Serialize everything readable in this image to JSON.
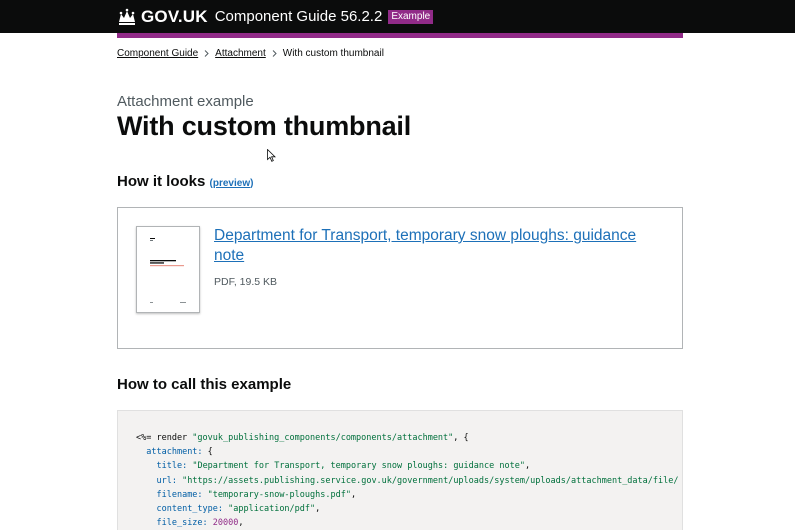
{
  "header": {
    "logo": "GOV.UK",
    "product": "Component Guide 56.2.2",
    "badge": "Example"
  },
  "breadcrumb": {
    "items": [
      "Component Guide",
      "Attachment"
    ],
    "current": "With custom thumbnail"
  },
  "page": {
    "caption": "Attachment example",
    "title": "With custom thumbnail"
  },
  "how_it_looks": {
    "heading": "How it looks",
    "preview_open": "(",
    "preview_label": "preview",
    "preview_close": ")"
  },
  "attachment": {
    "title": "Department for Transport, temporary snow ploughs: guidance note",
    "meta": "PDF, 19.5 KB"
  },
  "how_to_call": {
    "heading": "How to call this example"
  },
  "code": {
    "line1_prefix": "<%= render ",
    "line1_str": "\"govuk_publishing_components/components/attachment\"",
    "line1_suffix": ", {",
    "line2_key": "attachment:",
    "line2_rest": " {",
    "line3_key": "title:",
    "line3_str": "\"Department for Transport, temporary snow ploughs: guidance note\"",
    "line3_rest": ",",
    "line4_key": "url:",
    "line4_str": "\"https://assets.publishing.service.gov.uk/government/uploads/system/uploads/attachment_data/file/",
    "line5_key": "filename:",
    "line5_str": "\"temporary-snow-ploughs.pdf\"",
    "line5_rest": ",",
    "line6_key": "content_type:",
    "line6_str": "\"application/pdf\"",
    "line6_rest": ",",
    "line7_key": "file_size:",
    "line7_num": "20000",
    "line7_rest": ","
  },
  "colors": {
    "header_bg": "#0b0c0c",
    "accent": "#912b88",
    "link": "#1d70b8",
    "code_bg": "#f3f2f1"
  }
}
